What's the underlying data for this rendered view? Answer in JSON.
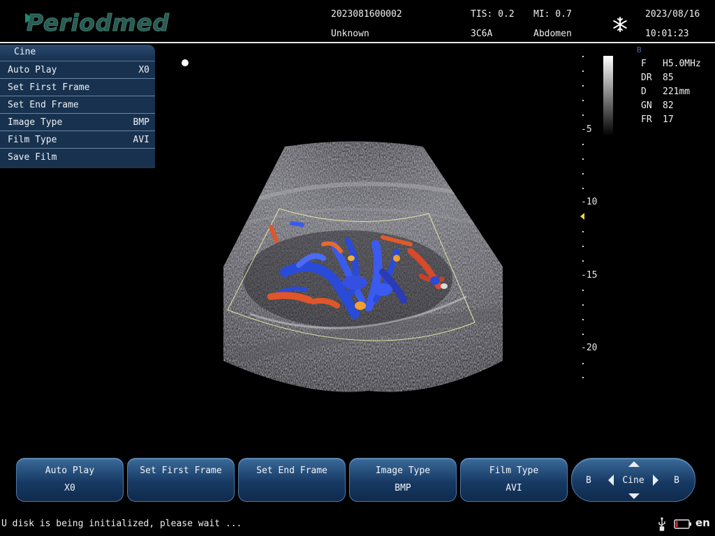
{
  "header": {
    "logo": "Periodmed",
    "patient_id": "2023081600002",
    "patient_name": "Unknown",
    "tis": "TIS: 0.2",
    "probe": "3C6A",
    "mi": "MI: 0.7",
    "exam": "Abdomen",
    "date": "2023/08/16",
    "time": "10:01:23",
    "freeze_icon": "snowflake-icon"
  },
  "cine_menu": {
    "title": "Cine",
    "items": [
      {
        "label": "Auto Play",
        "value": "X0"
      },
      {
        "label": "Set First Frame",
        "value": ""
      },
      {
        "label": "Set End Frame",
        "value": ""
      },
      {
        "label": "Image Type",
        "value": "BMP"
      },
      {
        "label": "Film Type",
        "value": "AVI"
      },
      {
        "label": "Save Film",
        "value": ""
      }
    ]
  },
  "depth_scale": {
    "labels": [
      "-5",
      "-10",
      "-15",
      "-20"
    ]
  },
  "params": {
    "mode": "B",
    "rows": [
      {
        "key": "F",
        "value": "H5.0MHz"
      },
      {
        "key": "DR",
        "value": "85"
      },
      {
        "key": "D",
        "value": "221mm"
      },
      {
        "key": "GN",
        "value": "82"
      },
      {
        "key": "FR",
        "value": "17"
      }
    ]
  },
  "softkeys": [
    {
      "top": "Auto Play",
      "bottom": "X0"
    },
    {
      "top": "Set First Frame",
      "bottom": ""
    },
    {
      "top": "Set End Frame",
      "bottom": ""
    },
    {
      "top": "Image Type",
      "bottom": "BMP"
    },
    {
      "top": "Film Type",
      "bottom": "AVI"
    }
  ],
  "cine_nav": {
    "left": "B",
    "center": "Cine",
    "right": "B"
  },
  "status": {
    "message": "U disk is being initialized, please wait ...",
    "language": "en",
    "usb_icon": "usb-icon",
    "battery_icon": "battery-icon",
    "battery_color": "#d42a2a"
  },
  "colors": {
    "menu_bg": "#17314e",
    "softkey_bg": "#173a64",
    "doppler_red": "#e0552a",
    "doppler_blue": "#2a4ad8"
  }
}
